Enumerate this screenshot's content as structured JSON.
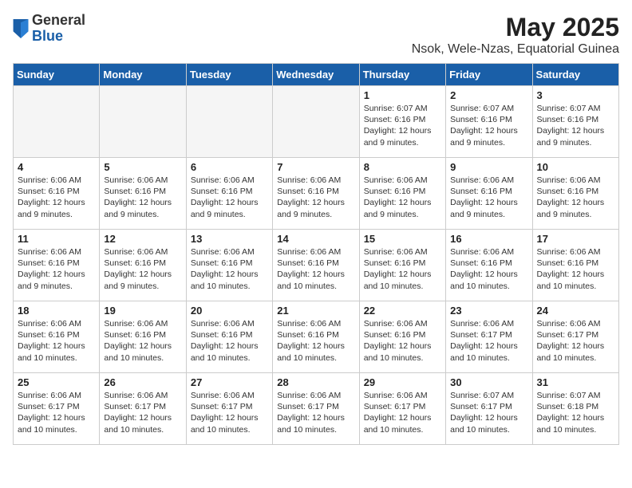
{
  "logo": {
    "general": "General",
    "blue": "Blue"
  },
  "title": "May 2025",
  "subtitle": "Nsok, Wele-Nzas, Equatorial Guinea",
  "days_of_week": [
    "Sunday",
    "Monday",
    "Tuesday",
    "Wednesday",
    "Thursday",
    "Friday",
    "Saturday"
  ],
  "weeks": [
    [
      {
        "day": "",
        "empty": true
      },
      {
        "day": "",
        "empty": true
      },
      {
        "day": "",
        "empty": true
      },
      {
        "day": "",
        "empty": true
      },
      {
        "day": "1",
        "sunrise": "6:07 AM",
        "sunset": "6:16 PM",
        "daylight": "12 hours and 9 minutes."
      },
      {
        "day": "2",
        "sunrise": "6:07 AM",
        "sunset": "6:16 PM",
        "daylight": "12 hours and 9 minutes."
      },
      {
        "day": "3",
        "sunrise": "6:07 AM",
        "sunset": "6:16 PM",
        "daylight": "12 hours and 9 minutes."
      }
    ],
    [
      {
        "day": "4",
        "sunrise": "6:06 AM",
        "sunset": "6:16 PM",
        "daylight": "12 hours and 9 minutes."
      },
      {
        "day": "5",
        "sunrise": "6:06 AM",
        "sunset": "6:16 PM",
        "daylight": "12 hours and 9 minutes."
      },
      {
        "day": "6",
        "sunrise": "6:06 AM",
        "sunset": "6:16 PM",
        "daylight": "12 hours and 9 minutes."
      },
      {
        "day": "7",
        "sunrise": "6:06 AM",
        "sunset": "6:16 PM",
        "daylight": "12 hours and 9 minutes."
      },
      {
        "day": "8",
        "sunrise": "6:06 AM",
        "sunset": "6:16 PM",
        "daylight": "12 hours and 9 minutes."
      },
      {
        "day": "9",
        "sunrise": "6:06 AM",
        "sunset": "6:16 PM",
        "daylight": "12 hours and 9 minutes."
      },
      {
        "day": "10",
        "sunrise": "6:06 AM",
        "sunset": "6:16 PM",
        "daylight": "12 hours and 9 minutes."
      }
    ],
    [
      {
        "day": "11",
        "sunrise": "6:06 AM",
        "sunset": "6:16 PM",
        "daylight": "12 hours and 9 minutes."
      },
      {
        "day": "12",
        "sunrise": "6:06 AM",
        "sunset": "6:16 PM",
        "daylight": "12 hours and 9 minutes."
      },
      {
        "day": "13",
        "sunrise": "6:06 AM",
        "sunset": "6:16 PM",
        "daylight": "12 hours and 10 minutes."
      },
      {
        "day": "14",
        "sunrise": "6:06 AM",
        "sunset": "6:16 PM",
        "daylight": "12 hours and 10 minutes."
      },
      {
        "day": "15",
        "sunrise": "6:06 AM",
        "sunset": "6:16 PM",
        "daylight": "12 hours and 10 minutes."
      },
      {
        "day": "16",
        "sunrise": "6:06 AM",
        "sunset": "6:16 PM",
        "daylight": "12 hours and 10 minutes."
      },
      {
        "day": "17",
        "sunrise": "6:06 AM",
        "sunset": "6:16 PM",
        "daylight": "12 hours and 10 minutes."
      }
    ],
    [
      {
        "day": "18",
        "sunrise": "6:06 AM",
        "sunset": "6:16 PM",
        "daylight": "12 hours and 10 minutes."
      },
      {
        "day": "19",
        "sunrise": "6:06 AM",
        "sunset": "6:16 PM",
        "daylight": "12 hours and 10 minutes."
      },
      {
        "day": "20",
        "sunrise": "6:06 AM",
        "sunset": "6:16 PM",
        "daylight": "12 hours and 10 minutes."
      },
      {
        "day": "21",
        "sunrise": "6:06 AM",
        "sunset": "6:16 PM",
        "daylight": "12 hours and 10 minutes."
      },
      {
        "day": "22",
        "sunrise": "6:06 AM",
        "sunset": "6:16 PM",
        "daylight": "12 hours and 10 minutes."
      },
      {
        "day": "23",
        "sunrise": "6:06 AM",
        "sunset": "6:17 PM",
        "daylight": "12 hours and 10 minutes."
      },
      {
        "day": "24",
        "sunrise": "6:06 AM",
        "sunset": "6:17 PM",
        "daylight": "12 hours and 10 minutes."
      }
    ],
    [
      {
        "day": "25",
        "sunrise": "6:06 AM",
        "sunset": "6:17 PM",
        "daylight": "12 hours and 10 minutes."
      },
      {
        "day": "26",
        "sunrise": "6:06 AM",
        "sunset": "6:17 PM",
        "daylight": "12 hours and 10 minutes."
      },
      {
        "day": "27",
        "sunrise": "6:06 AM",
        "sunset": "6:17 PM",
        "daylight": "12 hours and 10 minutes."
      },
      {
        "day": "28",
        "sunrise": "6:06 AM",
        "sunset": "6:17 PM",
        "daylight": "12 hours and 10 minutes."
      },
      {
        "day": "29",
        "sunrise": "6:06 AM",
        "sunset": "6:17 PM",
        "daylight": "12 hours and 10 minutes."
      },
      {
        "day": "30",
        "sunrise": "6:07 AM",
        "sunset": "6:17 PM",
        "daylight": "12 hours and 10 minutes."
      },
      {
        "day": "31",
        "sunrise": "6:07 AM",
        "sunset": "6:18 PM",
        "daylight": "12 hours and 10 minutes."
      }
    ]
  ]
}
